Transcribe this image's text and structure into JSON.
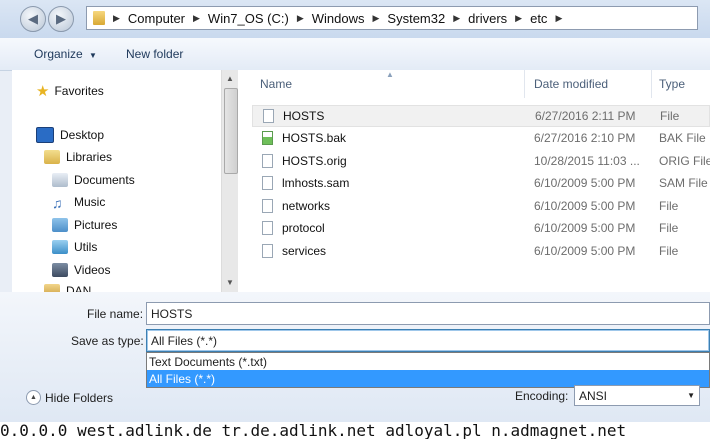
{
  "address": {
    "crumbs": [
      "Computer",
      "Win7_OS (C:)",
      "Windows",
      "System32",
      "drivers",
      "etc"
    ]
  },
  "toolbar": {
    "organize_label": "Organize",
    "new_folder_label": "New folder"
  },
  "nav": {
    "items": [
      {
        "label": "Favorites",
        "icon": "star-icon"
      },
      {
        "label": "Desktop",
        "icon": "desktop-icon"
      },
      {
        "label": "Libraries",
        "icon": "libraries-icon"
      },
      {
        "label": "Documents",
        "icon": "documents-icon"
      },
      {
        "label": "Music",
        "icon": "music-icon"
      },
      {
        "label": "Pictures",
        "icon": "pictures-icon"
      },
      {
        "label": "Utils",
        "icon": "utils-icon"
      },
      {
        "label": "Videos",
        "icon": "videos-icon"
      },
      {
        "label": "DAN",
        "icon": "user-icon"
      }
    ]
  },
  "file_list": {
    "columns": [
      "Name",
      "Date modified",
      "Type"
    ],
    "rows": [
      {
        "name": "HOSTS",
        "date": "6/27/2016 2:11 PM",
        "type": "File"
      },
      {
        "name": "HOSTS.bak",
        "date": "6/27/2016 2:10 PM",
        "type": "BAK File"
      },
      {
        "name": "HOSTS.orig",
        "date": "10/28/2015 11:03 ...",
        "type": "ORIG File"
      },
      {
        "name": "lmhosts.sam",
        "date": "6/10/2009 5:00 PM",
        "type": "SAM File"
      },
      {
        "name": "networks",
        "date": "6/10/2009 5:00 PM",
        "type": "File"
      },
      {
        "name": "protocol",
        "date": "6/10/2009 5:00 PM",
        "type": "File"
      },
      {
        "name": "services",
        "date": "6/10/2009 5:00 PM",
        "type": "File"
      }
    ]
  },
  "save_dialog": {
    "file_name_label": "File name:",
    "file_name_value": "HOSTS",
    "save_as_type_label": "Save as type:",
    "save_as_type_value": "All Files  (*.*)",
    "type_options": [
      "Text Documents (*.txt)",
      "All Files  (*.*)"
    ],
    "hide_folders_label": "Hide Folders",
    "encoding_label": "Encoding:",
    "encoding_value": "ANSI"
  },
  "background_text": "0.0.0.0 west.adlink.de tr.de.adlink.net adloyal.pl n.admagnet.net",
  "colors": {
    "selection": "#3399ff",
    "accent": "#1e395b"
  }
}
